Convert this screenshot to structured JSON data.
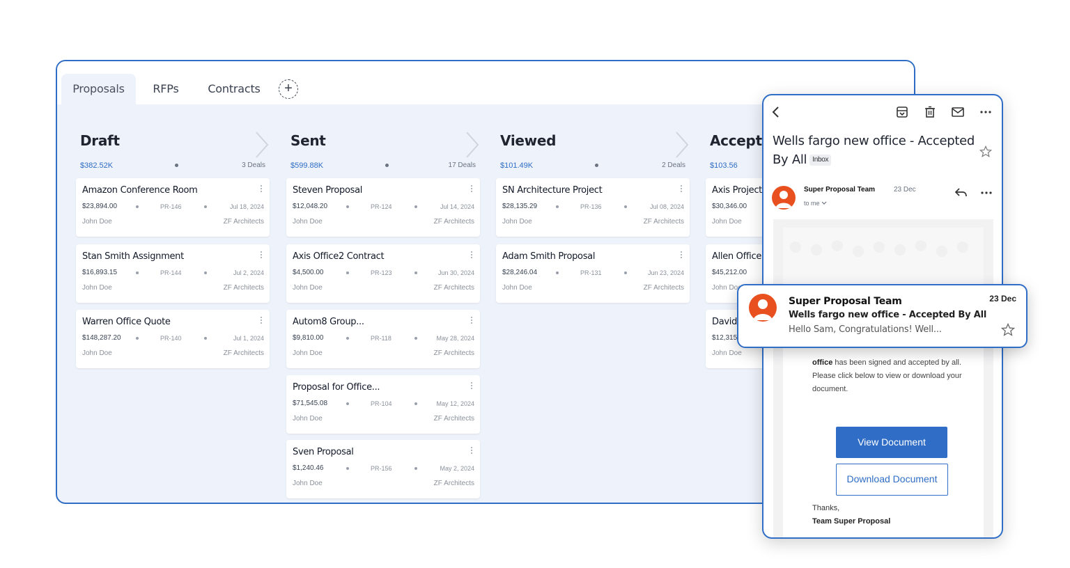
{
  "tabs": [
    {
      "label": "Proposals",
      "active": true
    },
    {
      "label": "RFPs",
      "active": false
    },
    {
      "label": "Contracts",
      "active": false
    }
  ],
  "add_tab_glyph": "+",
  "columns": [
    {
      "title": "Draft",
      "amount": "$382.52K",
      "deals": "3 Deals",
      "cards": [
        {
          "title": "Amazon Conference Room",
          "amount": "$23,894.00",
          "id": "PR-146",
          "date": "Jul 18, 2024",
          "owner": "John Doe",
          "company": "ZF Architects"
        },
        {
          "title": "Stan Smith Assignment",
          "amount": "$16,893.15",
          "id": "PR-144",
          "date": "Jul 2, 2024",
          "owner": "John Doe",
          "company": "ZF Architects"
        },
        {
          "title": "Warren Office Quote",
          "amount": "$148,287.20",
          "id": "PR-140",
          "date": "Jul 1, 2024",
          "owner": "John Doe",
          "company": "ZF Architects"
        }
      ]
    },
    {
      "title": "Sent",
      "amount": "$599.88K",
      "deals": "17 Deals",
      "cards": [
        {
          "title": "Steven Proposal",
          "amount": "$12,048.20",
          "id": "PR-124",
          "date": "Jul 14, 2024",
          "owner": "John Doe",
          "company": "ZF Architects"
        },
        {
          "title": "Axis Office2 Contract",
          "amount": "$4,500.00",
          "id": "PR-123",
          "date": "Jun 30, 2024",
          "owner": "John Doe",
          "company": "ZF Architects"
        },
        {
          "title": "Autom8 Group...",
          "amount": "$9,810.00",
          "id": "PR-118",
          "date": "May 28, 2024",
          "owner": "John Doe",
          "company": "ZF Architects"
        },
        {
          "title": "Proposal for Office...",
          "amount": "$71,545.08",
          "id": "PR-104",
          "date": "May 12, 2024",
          "owner": "John Doe",
          "company": "ZF Architects"
        },
        {
          "title": "Sven Proposal",
          "amount": "$1,240.46",
          "id": "PR-156",
          "date": "May 2, 2024",
          "owner": "John Doe",
          "company": "ZF Architects"
        }
      ]
    },
    {
      "title": "Viewed",
      "amount": "$101.49K",
      "deals": "2 Deals",
      "cards": [
        {
          "title": "SN Architecture Project",
          "amount": "$28,135.29",
          "id": "PR-136",
          "date": "Jul 08, 2024",
          "owner": "John Doe",
          "company": "ZF Architects"
        },
        {
          "title": "Adam Smith Proposal",
          "amount": "$28,246.04",
          "id": "PR-131",
          "date": "Jun 23, 2024",
          "owner": "John Doe",
          "company": "ZF Architects"
        }
      ]
    },
    {
      "title": "Accepted",
      "amount": "$103.56",
      "cards": [
        {
          "title": "Axis Project",
          "amount": "$30,346.00",
          "owner": "John Doe"
        },
        {
          "title": "Allen Office C",
          "amount": "$45,212.00",
          "owner": "John Doe"
        },
        {
          "title": "David I",
          "amount": "$12,315",
          "owner": "John Doe"
        }
      ]
    }
  ],
  "email": {
    "subject": "Wells fargo new office - Accepted By All",
    "label": "Inbox",
    "sender": "Super Proposal Team",
    "date": "23 Dec",
    "to": "to me",
    "body_bold": "office",
    "body_text": " has been signed and accepted by all. Please click below to view or download your document.",
    "view_button": "View Document",
    "download_button": "Download Document",
    "thanks": "Thanks,",
    "signoff": "Team Super Proposal"
  },
  "notification": {
    "sender": "Super Proposal Team",
    "date": "23 Dec",
    "subject": "Wells fargo new office - Accepted By All",
    "preview": "Hello  Sam, Congratulations! Well..."
  },
  "colors": {
    "accent": "#2f6dc6",
    "board_bg": "#eef2fa",
    "avatar": "#e8501f"
  }
}
